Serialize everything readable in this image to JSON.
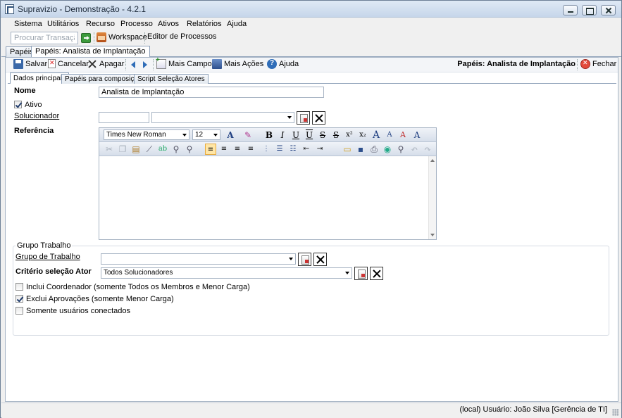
{
  "window": {
    "title": "Supravizio - Demonstração - 4.2.1",
    "buttons": [
      "minimize",
      "maximize",
      "close"
    ]
  },
  "menu": [
    "Sistema",
    "Utilitários",
    "Recurso",
    "Processo",
    "Ativos",
    "Relatórios",
    "Ajuda"
  ],
  "toolbar": {
    "search_placeholder": "Procurar Transação",
    "workspace_label": "Workspace",
    "editor_label": "Editor de Processos"
  },
  "doc_tabs": [
    "Papéis",
    "Papéis: Analista de Implantação"
  ],
  "actions": {
    "save": "Salvar",
    "cancel": "Cancelar",
    "delete": "Apagar",
    "more_fields": "Mais Campos",
    "more_actions": "Mais Ações",
    "help": "Ajuda",
    "title": "Papéis: Analista de Implantação",
    "close": "Fechar"
  },
  "inner_tabs": [
    "Dados principais",
    "Papéis para composição",
    "Script Seleção Atores"
  ],
  "form": {
    "nome_label": "Nome",
    "nome_value": "Analista de Implantação",
    "ativo_label": "Ativo",
    "ativo_checked": true,
    "solucionador_label": "Solucionador",
    "solucionador_code": "",
    "solucionador_value": "",
    "referencia_label": "Referência",
    "editor": {
      "font": "Times New Roman",
      "size": "12"
    }
  },
  "group": {
    "legend": "Grupo Trabalho",
    "grupo_label": "Grupo de Trabalho",
    "grupo_value": "",
    "criterio_label": "Critério seleção Ator",
    "criterio_value": "Todos Solucionadores",
    "checks": [
      {
        "label": "Inclui Coordenador (somente Todos os Membros e Menor Carga)",
        "checked": false
      },
      {
        "label": "Exclui Aprovações (somente Menor Carga)",
        "checked": true
      },
      {
        "label": "Somente usuários conectados",
        "checked": false
      }
    ]
  },
  "status": "(local)  Usuário: João Silva [Gerência de TI]"
}
